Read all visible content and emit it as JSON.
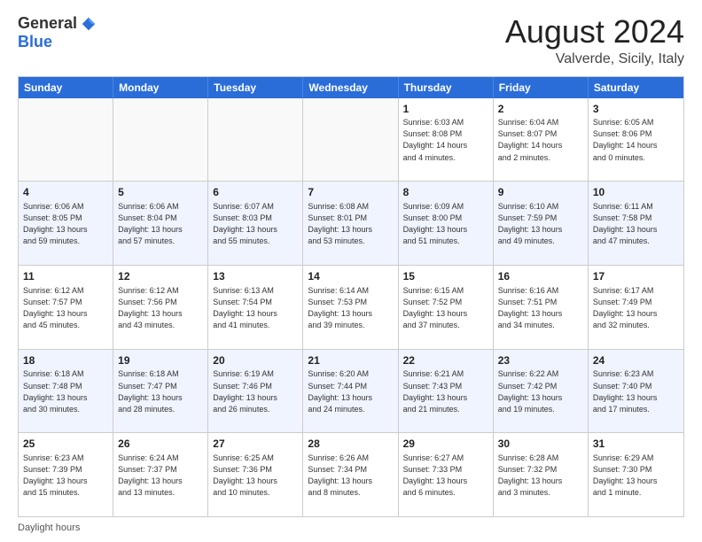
{
  "logo": {
    "general": "General",
    "blue": "Blue"
  },
  "title": {
    "month_year": "August 2024",
    "location": "Valverde, Sicily, Italy"
  },
  "header_days": [
    "Sunday",
    "Monday",
    "Tuesday",
    "Wednesday",
    "Thursday",
    "Friday",
    "Saturday"
  ],
  "rows": [
    {
      "alt": false,
      "cells": [
        {
          "day": "",
          "info": ""
        },
        {
          "day": "",
          "info": ""
        },
        {
          "day": "",
          "info": ""
        },
        {
          "day": "",
          "info": ""
        },
        {
          "day": "1",
          "info": "Sunrise: 6:03 AM\nSunset: 8:08 PM\nDaylight: 14 hours\nand 4 minutes."
        },
        {
          "day": "2",
          "info": "Sunrise: 6:04 AM\nSunset: 8:07 PM\nDaylight: 14 hours\nand 2 minutes."
        },
        {
          "day": "3",
          "info": "Sunrise: 6:05 AM\nSunset: 8:06 PM\nDaylight: 14 hours\nand 0 minutes."
        }
      ]
    },
    {
      "alt": true,
      "cells": [
        {
          "day": "4",
          "info": "Sunrise: 6:06 AM\nSunset: 8:05 PM\nDaylight: 13 hours\nand 59 minutes."
        },
        {
          "day": "5",
          "info": "Sunrise: 6:06 AM\nSunset: 8:04 PM\nDaylight: 13 hours\nand 57 minutes."
        },
        {
          "day": "6",
          "info": "Sunrise: 6:07 AM\nSunset: 8:03 PM\nDaylight: 13 hours\nand 55 minutes."
        },
        {
          "day": "7",
          "info": "Sunrise: 6:08 AM\nSunset: 8:01 PM\nDaylight: 13 hours\nand 53 minutes."
        },
        {
          "day": "8",
          "info": "Sunrise: 6:09 AM\nSunset: 8:00 PM\nDaylight: 13 hours\nand 51 minutes."
        },
        {
          "day": "9",
          "info": "Sunrise: 6:10 AM\nSunset: 7:59 PM\nDaylight: 13 hours\nand 49 minutes."
        },
        {
          "day": "10",
          "info": "Sunrise: 6:11 AM\nSunset: 7:58 PM\nDaylight: 13 hours\nand 47 minutes."
        }
      ]
    },
    {
      "alt": false,
      "cells": [
        {
          "day": "11",
          "info": "Sunrise: 6:12 AM\nSunset: 7:57 PM\nDaylight: 13 hours\nand 45 minutes."
        },
        {
          "day": "12",
          "info": "Sunrise: 6:12 AM\nSunset: 7:56 PM\nDaylight: 13 hours\nand 43 minutes."
        },
        {
          "day": "13",
          "info": "Sunrise: 6:13 AM\nSunset: 7:54 PM\nDaylight: 13 hours\nand 41 minutes."
        },
        {
          "day": "14",
          "info": "Sunrise: 6:14 AM\nSunset: 7:53 PM\nDaylight: 13 hours\nand 39 minutes."
        },
        {
          "day": "15",
          "info": "Sunrise: 6:15 AM\nSunset: 7:52 PM\nDaylight: 13 hours\nand 37 minutes."
        },
        {
          "day": "16",
          "info": "Sunrise: 6:16 AM\nSunset: 7:51 PM\nDaylight: 13 hours\nand 34 minutes."
        },
        {
          "day": "17",
          "info": "Sunrise: 6:17 AM\nSunset: 7:49 PM\nDaylight: 13 hours\nand 32 minutes."
        }
      ]
    },
    {
      "alt": true,
      "cells": [
        {
          "day": "18",
          "info": "Sunrise: 6:18 AM\nSunset: 7:48 PM\nDaylight: 13 hours\nand 30 minutes."
        },
        {
          "day": "19",
          "info": "Sunrise: 6:18 AM\nSunset: 7:47 PM\nDaylight: 13 hours\nand 28 minutes."
        },
        {
          "day": "20",
          "info": "Sunrise: 6:19 AM\nSunset: 7:46 PM\nDaylight: 13 hours\nand 26 minutes."
        },
        {
          "day": "21",
          "info": "Sunrise: 6:20 AM\nSunset: 7:44 PM\nDaylight: 13 hours\nand 24 minutes."
        },
        {
          "day": "22",
          "info": "Sunrise: 6:21 AM\nSunset: 7:43 PM\nDaylight: 13 hours\nand 21 minutes."
        },
        {
          "day": "23",
          "info": "Sunrise: 6:22 AM\nSunset: 7:42 PM\nDaylight: 13 hours\nand 19 minutes."
        },
        {
          "day": "24",
          "info": "Sunrise: 6:23 AM\nSunset: 7:40 PM\nDaylight: 13 hours\nand 17 minutes."
        }
      ]
    },
    {
      "alt": false,
      "cells": [
        {
          "day": "25",
          "info": "Sunrise: 6:23 AM\nSunset: 7:39 PM\nDaylight: 13 hours\nand 15 minutes."
        },
        {
          "day": "26",
          "info": "Sunrise: 6:24 AM\nSunset: 7:37 PM\nDaylight: 13 hours\nand 13 minutes."
        },
        {
          "day": "27",
          "info": "Sunrise: 6:25 AM\nSunset: 7:36 PM\nDaylight: 13 hours\nand 10 minutes."
        },
        {
          "day": "28",
          "info": "Sunrise: 6:26 AM\nSunset: 7:34 PM\nDaylight: 13 hours\nand 8 minutes."
        },
        {
          "day": "29",
          "info": "Sunrise: 6:27 AM\nSunset: 7:33 PM\nDaylight: 13 hours\nand 6 minutes."
        },
        {
          "day": "30",
          "info": "Sunrise: 6:28 AM\nSunset: 7:32 PM\nDaylight: 13 hours\nand 3 minutes."
        },
        {
          "day": "31",
          "info": "Sunrise: 6:29 AM\nSunset: 7:30 PM\nDaylight: 13 hours\nand 1 minute."
        }
      ]
    }
  ],
  "footer": {
    "label": "Daylight hours"
  }
}
